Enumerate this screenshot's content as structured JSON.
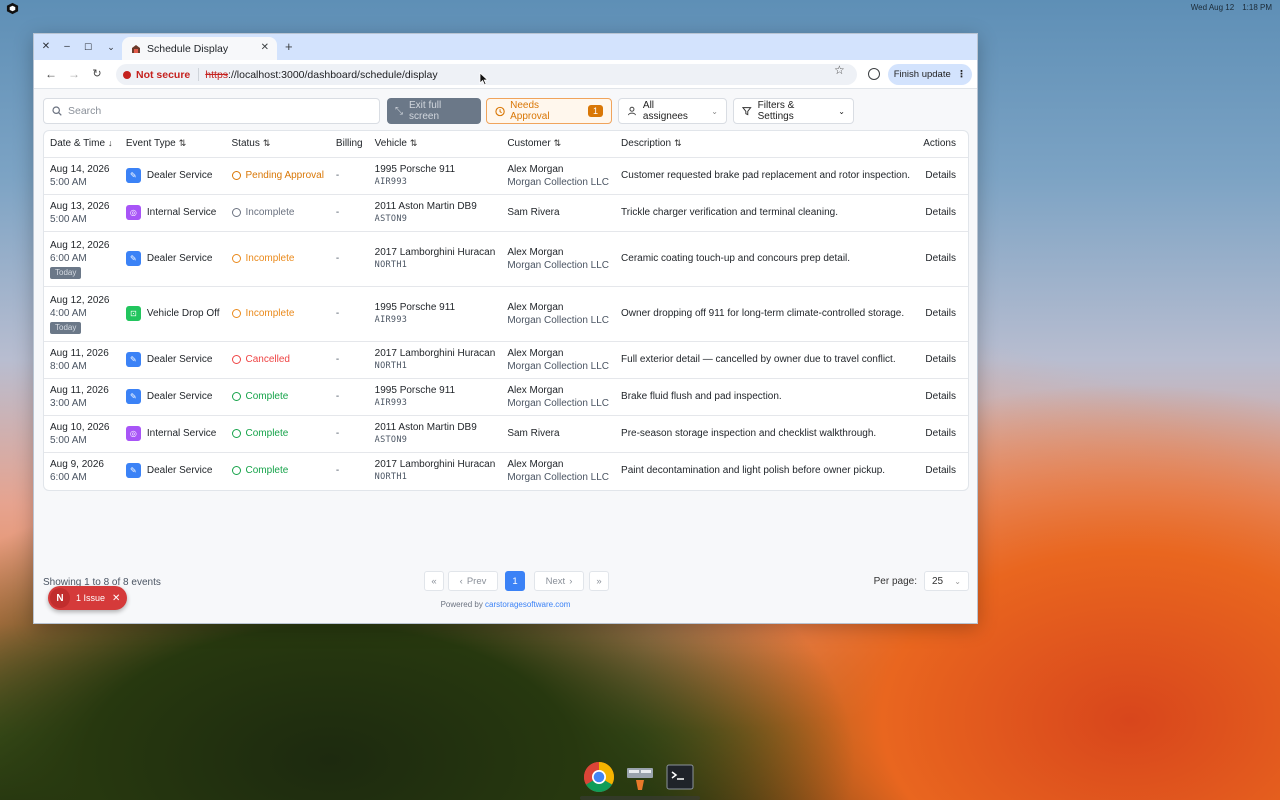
{
  "os": {
    "date": "Wed Aug 12",
    "time": "1:18 PM"
  },
  "browser": {
    "tab_title": "Schedule Display",
    "not_secure": "Not secure",
    "url_scheme": "https",
    "url_rest": "://localhost:3000/dashboard/schedule/display",
    "finish_update": "Finish update"
  },
  "toolbar": {
    "search_placeholder": "Search",
    "exit_fullscreen": "Exit full screen",
    "needs_approval": "Needs Approval",
    "needs_approval_count": "1",
    "assignees": "All assignees",
    "filters": "Filters & Settings"
  },
  "table": {
    "headers": {
      "datetime": "Date & Time",
      "event_type": "Event Type",
      "status": "Status",
      "billing": "Billing",
      "vehicle": "Vehicle",
      "customer": "Customer",
      "description": "Description",
      "actions": "Actions"
    },
    "rows": [
      {
        "date": "Aug 14, 2026",
        "time": "5:00 AM",
        "today": "",
        "event": "Dealer Service",
        "status": "Pending Approval",
        "billing": "-",
        "vehicle": "1995 Porsche 911",
        "plate": "AIR993",
        "customer": "Alex Morgan",
        "company": "Morgan Collection LLC",
        "description": "Customer requested brake pad replacement and rotor inspection.",
        "action": "Details"
      },
      {
        "date": "Aug 13, 2026",
        "time": "5:00 AM",
        "today": "",
        "event": "Internal Service",
        "status": "Incomplete",
        "billing": "-",
        "vehicle": "2011 Aston Martin DB9",
        "plate": "ASTON9",
        "customer": "Sam Rivera",
        "company": "",
        "description": "Trickle charger verification and terminal cleaning.",
        "action": "Details"
      },
      {
        "date": "Aug 12, 2026",
        "time": "6:00 AM",
        "today": "Today",
        "event": "Dealer Service",
        "status": "Incomplete",
        "billing": "-",
        "vehicle": "2017 Lamborghini Huracan",
        "plate": "NORTH1",
        "customer": "Alex Morgan",
        "company": "Morgan Collection LLC",
        "description": "Ceramic coating touch-up and concours prep detail.",
        "action": "Details"
      },
      {
        "date": "Aug 12, 2026",
        "time": "4:00 AM",
        "today": "Today",
        "event": "Vehicle Drop Off",
        "status": "Incomplete",
        "billing": "-",
        "vehicle": "1995 Porsche 911",
        "plate": "AIR993",
        "customer": "Alex Morgan",
        "company": "Morgan Collection LLC",
        "description": "Owner dropping off 911 for long-term climate-controlled storage.",
        "action": "Details"
      },
      {
        "date": "Aug 11, 2026",
        "time": "8:00 AM",
        "today": "",
        "event": "Dealer Service",
        "status": "Cancelled",
        "billing": "-",
        "vehicle": "2017 Lamborghini Huracan",
        "plate": "NORTH1",
        "customer": "Alex Morgan",
        "company": "Morgan Collection LLC",
        "description": "Full exterior detail — cancelled by owner due to travel conflict.",
        "action": "Details"
      },
      {
        "date": "Aug 11, 2026",
        "time": "3:00 AM",
        "today": "",
        "event": "Dealer Service",
        "status": "Complete",
        "billing": "-",
        "vehicle": "1995 Porsche 911",
        "plate": "AIR993",
        "customer": "Alex Morgan",
        "company": "Morgan Collection LLC",
        "description": "Brake fluid flush and pad inspection.",
        "action": "Details"
      },
      {
        "date": "Aug 10, 2026",
        "time": "5:00 AM",
        "today": "",
        "event": "Internal Service",
        "status": "Complete",
        "billing": "-",
        "vehicle": "2011 Aston Martin DB9",
        "plate": "ASTON9",
        "customer": "Sam Rivera",
        "company": "",
        "description": "Pre-season storage inspection and checklist walkthrough.",
        "action": "Details"
      },
      {
        "date": "Aug 9, 2026",
        "time": "6:00 AM",
        "today": "",
        "event": "Dealer Service",
        "status": "Complete",
        "billing": "-",
        "vehicle": "2017 Lamborghini Huracan",
        "plate": "NORTH1",
        "customer": "Alex Morgan",
        "company": "Morgan Collection LLC",
        "description": "Paint decontamination and light polish before owner pickup.",
        "action": "Details"
      }
    ]
  },
  "pagination": {
    "showing": "Showing 1 to 8 of 8 events",
    "first": "«",
    "prev": "Prev",
    "current": "1",
    "next": "Next",
    "last": "»",
    "per_page_label": "Per page:",
    "per_page_value": "25"
  },
  "powered": {
    "prefix": "Powered by ",
    "link": "carstoragesoftware.com"
  },
  "issue": {
    "letter": "N",
    "label": "1 Issue"
  },
  "colors": {
    "dealer_service": "#3b82f6",
    "internal_service": "#a855f7",
    "vehicle_drop_off": "#22c55e",
    "pending": "#d97706",
    "incomplete_orange": "#ea8a1c",
    "incomplete_gray": "#6b7280",
    "cancelled": "#ef4444",
    "complete": "#16a34a"
  }
}
